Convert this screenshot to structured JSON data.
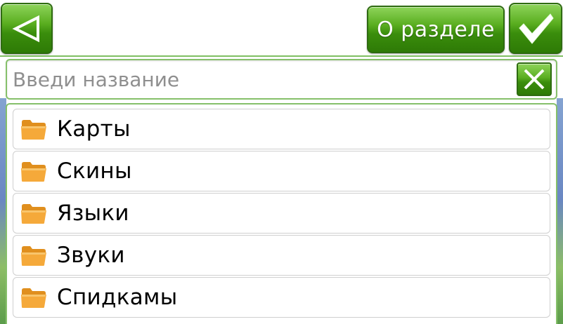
{
  "header": {
    "back_icon": "triangle-left-outline-icon",
    "about_label": "О разделе",
    "ok_icon": "checkmark-icon"
  },
  "search": {
    "placeholder": "Введи название",
    "value": "",
    "clear_icon": "close-x-icon"
  },
  "list": {
    "item_icon": "folder-icon",
    "items": [
      {
        "label": "Карты"
      },
      {
        "label": "Скины"
      },
      {
        "label": "Языки"
      },
      {
        "label": "Звуки"
      },
      {
        "label": "Спидкамы"
      }
    ]
  },
  "colors": {
    "accent_green": "#3a8d0c",
    "border_green": "#86c06a",
    "folder_orange": "#f5a93a",
    "placeholder_gray": "#8f8f8f"
  }
}
